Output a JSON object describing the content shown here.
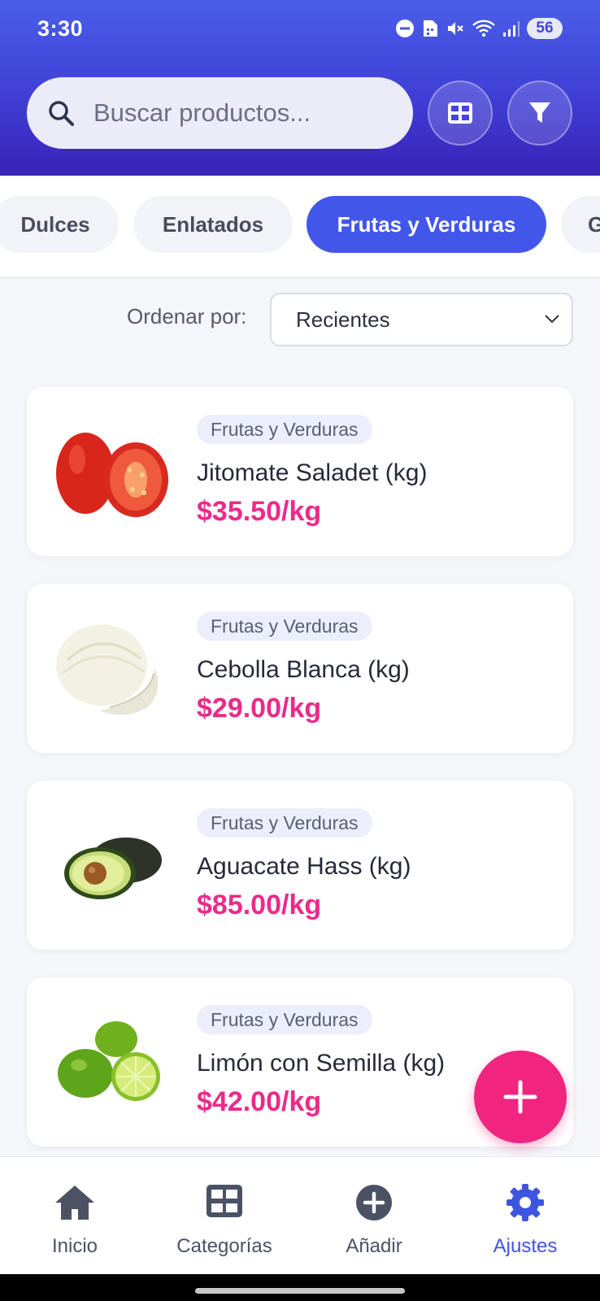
{
  "status_bar": {
    "time": "3:30",
    "battery": "56"
  },
  "header": {
    "search": {
      "placeholder": "Buscar productos...",
      "value": ""
    },
    "grid_button_icon": "grid-icon",
    "filter_button_icon": "filter-icon"
  },
  "tabs": [
    {
      "label": "Dulces",
      "active": false
    },
    {
      "label": "Enlatados",
      "active": false
    },
    {
      "label": "Frutas y Verduras",
      "active": true
    },
    {
      "label": "G",
      "active": false
    }
  ],
  "sort": {
    "label": "Ordenar por:",
    "selected": "Recientes"
  },
  "products": [
    {
      "category": "Frutas y Verduras",
      "name": "Jitomate Saladet (kg)",
      "price": "$35.50/kg",
      "image": "tomato-image"
    },
    {
      "category": "Frutas y Verduras",
      "name": "Cebolla Blanca (kg)",
      "price": "$29.00/kg",
      "image": "onion-image"
    },
    {
      "category": "Frutas y Verduras",
      "name": "Aguacate Hass (kg)",
      "price": "$85.00/kg",
      "image": "avocado-image"
    },
    {
      "category": "Frutas y Verduras",
      "name": "Limón con Semilla (kg)",
      "price": "$42.00/kg",
      "image": "lime-image"
    }
  ],
  "fab_icon": "plus-icon",
  "bottom_nav": [
    {
      "label": "Inicio",
      "icon": "home-icon",
      "active": false
    },
    {
      "label": "Categorías",
      "icon": "grid-icon",
      "active": false
    },
    {
      "label": "Añadir",
      "icon": "add-circle-icon",
      "active": false
    },
    {
      "label": "Ajustes",
      "icon": "gear-icon",
      "active": true
    }
  ],
  "colors": {
    "primary": "#4257ea",
    "header_gradient_end": "#3a22b8",
    "price": "#ec2a8a",
    "fab": "#f0257f"
  }
}
